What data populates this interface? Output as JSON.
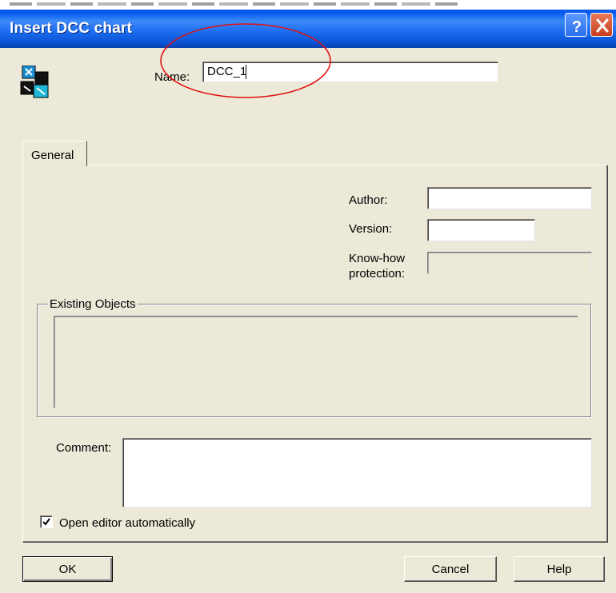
{
  "window": {
    "title": "Insert DCC chart",
    "help_glyph": "?",
    "close_glyph": "✕"
  },
  "header": {
    "name_label": "Name:",
    "name_value": "DCC_1",
    "icon": "dcc-chart-icon"
  },
  "tabs": [
    {
      "label": "General",
      "active": true
    }
  ],
  "general": {
    "author_label": "Author:",
    "author_value": "",
    "version_label": "Version:",
    "version_value": "",
    "knowhow_label_line1": "Know-how",
    "knowhow_label_line2": "protection:",
    "knowhow_value": "",
    "existing_objects_label": "Existing Objects",
    "comment_label": "Comment:",
    "comment_value": "",
    "open_editor_label": "Open editor automatically",
    "open_editor_checked": true
  },
  "buttons": {
    "ok": "OK",
    "cancel": "Cancel",
    "help": "Help"
  },
  "colors": {
    "titlebar": "#0058ee",
    "dialog_bg": "#ece9d8",
    "highlight_circle": "#e01010",
    "close_button": "#c8401c"
  }
}
